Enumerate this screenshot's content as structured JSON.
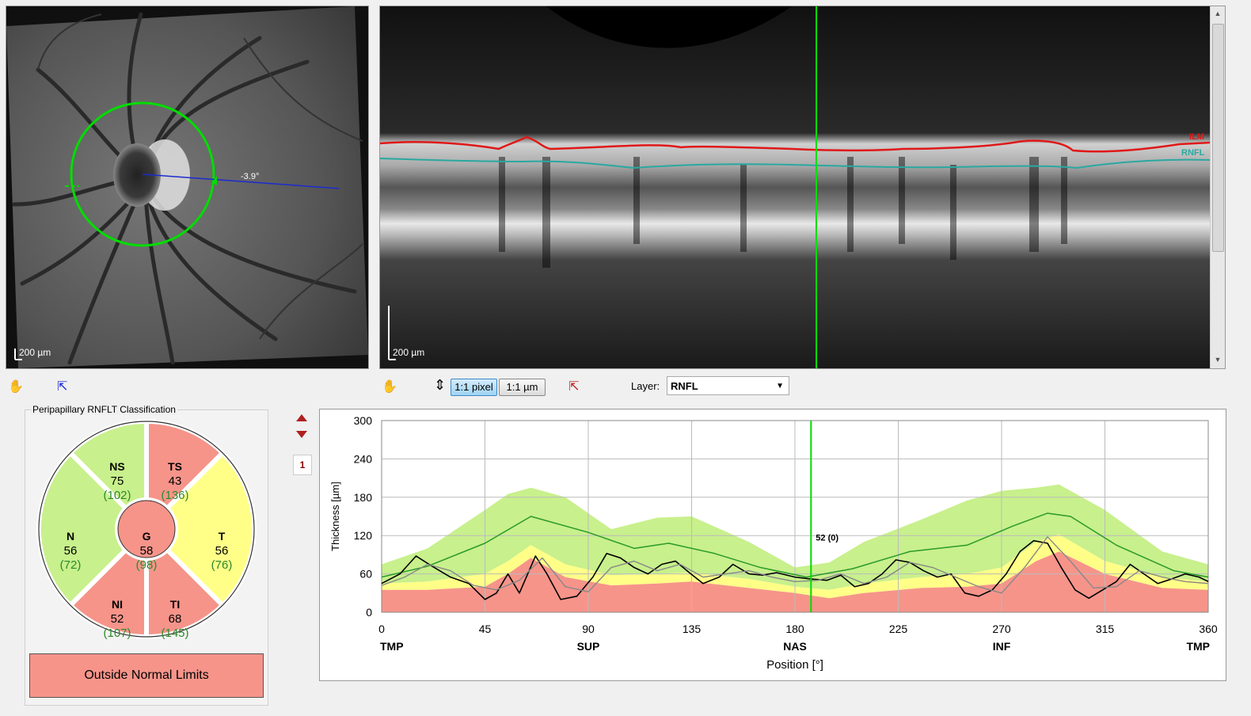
{
  "fundus": {
    "angle_label": "-3.9°",
    "scale_label": "200 µm"
  },
  "bscan": {
    "scale_label": "200 µm",
    "ilm_label": "ILM",
    "rnfl_label": "RNFL"
  },
  "toolbar": {
    "btn_pixel": "1:1 pixel",
    "btn_um": "1:1 µm",
    "layer_label": "Layer:",
    "layer_value": "RNFL"
  },
  "classification": {
    "title": "Peripapillary RNFLT Classification",
    "result": "Outside Normal Limits",
    "sectors": {
      "NS": {
        "label": "NS",
        "value": "75",
        "normal": "(102)"
      },
      "TS": {
        "label": "TS",
        "value": "43",
        "normal": "(136)"
      },
      "N": {
        "label": "N",
        "value": "56",
        "normal": "(72)"
      },
      "G": {
        "label": "G",
        "value": "58",
        "normal": "(98)"
      },
      "T": {
        "label": "T",
        "value": "56",
        "normal": "(76)"
      },
      "NI": {
        "label": "NI",
        "value": "52",
        "normal": "(107)"
      },
      "TI": {
        "label": "TI",
        "value": "68",
        "normal": "(145)"
      }
    }
  },
  "page_indicator": "1",
  "colors": {
    "normal": "#c8f08c",
    "borderline": "#ffff88",
    "outside": "#f6948a",
    "accent_green": "#00dd00"
  },
  "chart_data": {
    "type": "line",
    "xlabel": "Position [°]",
    "ylabel": "Thickness [µm]",
    "xlim": [
      0,
      360
    ],
    "ylim": [
      0,
      300
    ],
    "xticks": [
      0,
      45,
      90,
      135,
      180,
      225,
      270,
      315,
      360
    ],
    "yticks": [
      0,
      60,
      120,
      180,
      240,
      300
    ],
    "region_labels": [
      {
        "x": 0,
        "label": "TMP"
      },
      {
        "x": 90,
        "label": "SUP"
      },
      {
        "x": 180,
        "label": "NAS"
      },
      {
        "x": 270,
        "label": "INF"
      },
      {
        "x": 360,
        "label": "TMP"
      }
    ],
    "cursor": {
      "x": 187,
      "label": "52 (0)"
    },
    "grid": true,
    "bands": {
      "x": [
        0,
        20,
        45,
        55,
        65,
        80,
        100,
        120,
        135,
        160,
        180,
        195,
        210,
        235,
        255,
        270,
        285,
        295,
        315,
        340,
        360
      ],
      "outside": [
        35,
        35,
        40,
        60,
        85,
        55,
        42,
        45,
        48,
        38,
        30,
        22,
        30,
        38,
        40,
        45,
        80,
        95,
        60,
        38,
        35
      ],
      "border": [
        45,
        48,
        60,
        80,
        105,
        75,
        58,
        60,
        62,
        52,
        40,
        35,
        45,
        55,
        60,
        70,
        110,
        122,
        80,
        55,
        48
      ],
      "normal_top": [
        75,
        100,
        160,
        185,
        195,
        180,
        130,
        148,
        150,
        110,
        70,
        78,
        110,
        145,
        175,
        190,
        195,
        200,
        160,
        95,
        75
      ]
    },
    "series": [
      {
        "name": "normal_mean",
        "x": [
          0,
          20,
          45,
          65,
          90,
          110,
          125,
          145,
          165,
          185,
          205,
          230,
          255,
          275,
          290,
          300,
          320,
          345,
          360
        ],
        "values": [
          55,
          72,
          108,
          150,
          125,
          100,
          108,
          92,
          70,
          55,
          68,
          95,
          105,
          135,
          155,
          150,
          105,
          65,
          55
        ]
      },
      {
        "name": "measured",
        "x": [
          0,
          8,
          15,
          22,
          30,
          38,
          45,
          50,
          55,
          60,
          67,
          72,
          78,
          85,
          92,
          98,
          104,
          110,
          116,
          122,
          128,
          134,
          140,
          147,
          153,
          160,
          166,
          172,
          180,
          187,
          194,
          200,
          206,
          212,
          218,
          224,
          230,
          236,
          242,
          248,
          254,
          260,
          266,
          272,
          278,
          284,
          290,
          296,
          302,
          308,
          314,
          320,
          326,
          332,
          338,
          344,
          350,
          356,
          360
        ],
        "values": [
          45,
          60,
          88,
          72,
          55,
          45,
          20,
          30,
          60,
          30,
          88,
          60,
          20,
          25,
          55,
          92,
          85,
          70,
          60,
          75,
          80,
          62,
          45,
          55,
          75,
          60,
          58,
          62,
          55,
          52,
          50,
          58,
          40,
          45,
          60,
          82,
          78,
          65,
          55,
          60,
          30,
          25,
          35,
          60,
          95,
          112,
          108,
          70,
          35,
          22,
          35,
          48,
          75,
          60,
          45,
          52,
          60,
          55,
          48
        ]
      },
      {
        "name": "prior",
        "x": [
          0,
          10,
          20,
          30,
          40,
          50,
          60,
          70,
          80,
          90,
          100,
          110,
          120,
          130,
          140,
          150,
          160,
          170,
          180,
          190,
          200,
          210,
          220,
          230,
          240,
          250,
          260,
          270,
          280,
          290,
          300,
          310,
          320,
          330,
          340,
          350,
          360
        ],
        "values": [
          42,
          55,
          75,
          65,
          42,
          35,
          50,
          85,
          40,
          32,
          70,
          80,
          65,
          75,
          55,
          60,
          65,
          55,
          48,
          50,
          60,
          45,
          55,
          78,
          70,
          55,
          40,
          30,
          70,
          118,
          80,
          38,
          40,
          65,
          55,
          48,
          45
        ]
      }
    ]
  }
}
